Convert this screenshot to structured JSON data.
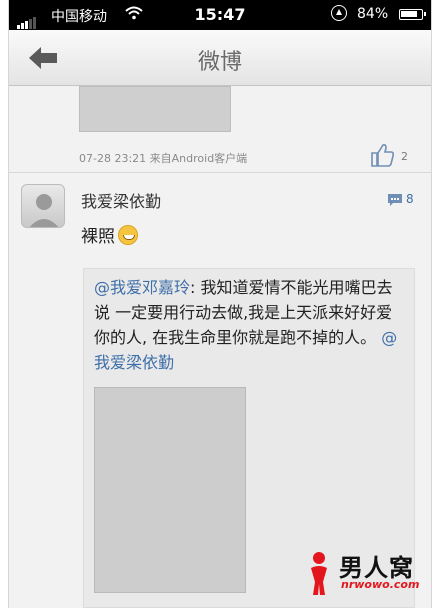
{
  "status_bar": {
    "carrier": "中国移动",
    "time": "15:47",
    "battery": "84%",
    "battery_level": 0.84
  },
  "nav": {
    "title": "微博",
    "back_icon": "back-arrow-icon"
  },
  "previous_post": {
    "meta": "07-28 23:21  来自Android客户端",
    "like_count": "2",
    "like_icon": "thumbs-up-icon"
  },
  "post": {
    "username": "我爱梁依勤",
    "comment_count": "8",
    "comment_icon": "comment-icon",
    "text": "裸照",
    "emoji": "grinning-emoji-icon",
    "repost": {
      "mention_author": "@我爱邓嘉玲",
      "body": ": 我知道爱情不能光用嘴巴去说 一定要用行动去做,我是上天派来好好爱你的人, 在我生命里你就是跑不掉的人。",
      "mention_end": "@我爱梁依勤"
    }
  },
  "watermark": {
    "title": "男人窝",
    "url": "nrwowo.com"
  },
  "colors": {
    "link": "#3e6fa8",
    "watermark_red": "#e4161d"
  }
}
